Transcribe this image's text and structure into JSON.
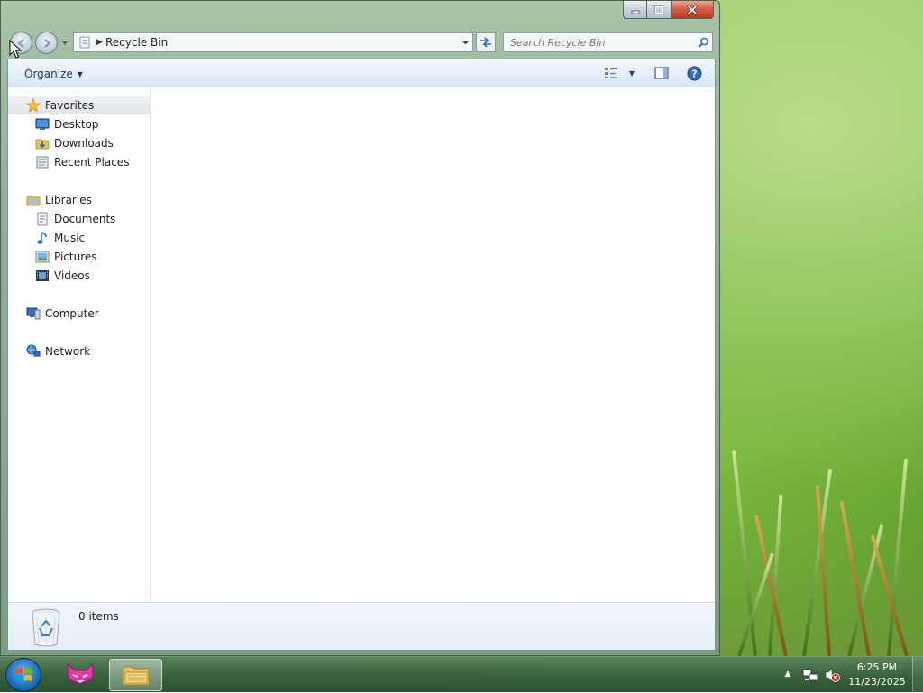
{
  "window": {
    "controls": {
      "minimize_icon": "minimize-icon",
      "maximize_icon": "maximize-icon",
      "close_icon": "close-icon"
    }
  },
  "navbar": {
    "address": "Recycle Bin",
    "search_placeholder": "Search Recycle Bin"
  },
  "toolbar": {
    "organize_label": "Organize"
  },
  "nav_pane": {
    "favorites": {
      "label": "Favorites",
      "items": [
        "Desktop",
        "Downloads",
        "Recent Places"
      ]
    },
    "libraries": {
      "label": "Libraries",
      "items": [
        "Documents",
        "Music",
        "Pictures",
        "Videos"
      ]
    },
    "computer": "Computer",
    "network": "Network"
  },
  "details": {
    "item_count": "0 items"
  },
  "taskbar": {
    "time": "6:25 PM",
    "date": "11/23/2025"
  },
  "colors": {
    "accent": "#1e395b",
    "toolbar_bg": "#e7eff8",
    "selected_row": "#e1e4e8",
    "taskbar": "#375f3e"
  }
}
